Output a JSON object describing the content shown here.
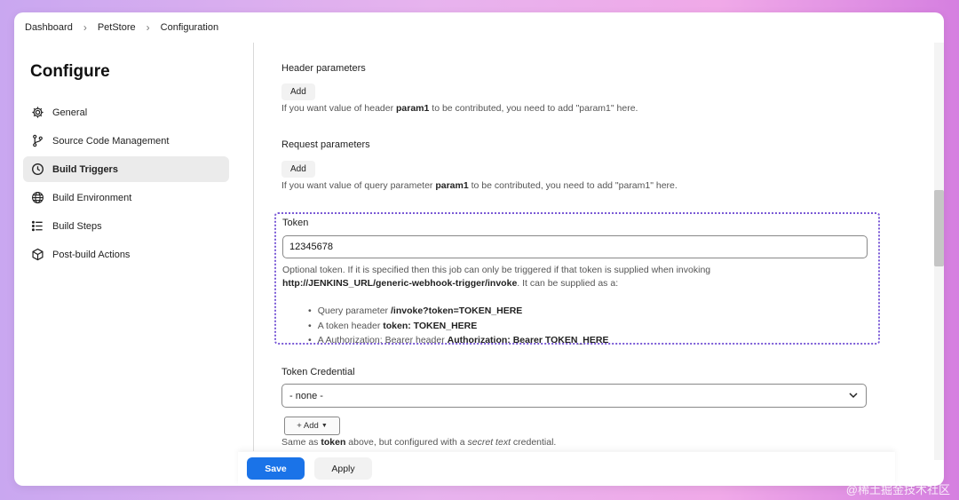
{
  "breadcrumb": [
    "Dashboard",
    "PetStore",
    "Configuration"
  ],
  "sidebar": {
    "title": "Configure",
    "items": [
      {
        "label": "General",
        "icon": "gear-icon",
        "active": false
      },
      {
        "label": "Source Code Management",
        "icon": "branch-icon",
        "active": false
      },
      {
        "label": "Build Triggers",
        "icon": "clock-icon",
        "active": true
      },
      {
        "label": "Build Environment",
        "icon": "globe-icon",
        "active": false
      },
      {
        "label": "Build Steps",
        "icon": "list-icon",
        "active": false
      },
      {
        "label": "Post-build Actions",
        "icon": "cube-icon",
        "active": false
      }
    ]
  },
  "header_params": {
    "label": "Header parameters",
    "add_label": "Add",
    "help_pre": "If you want value of header ",
    "help_bold": "param1",
    "help_post": " to be contributed, you need to add \"param1\" here."
  },
  "request_params": {
    "label": "Request parameters",
    "add_label": "Add",
    "help_pre": "If you want value of query parameter ",
    "help_bold": "param1",
    "help_post": " to be contributed, you need to add \"param1\" here."
  },
  "token": {
    "label": "Token",
    "value": "12345678",
    "help_line1": "Optional token. If it is specified then this job can only be triggered if that token is supplied when invoking",
    "help_url": "http://JENKINS_URL/generic-webhook-trigger/invoke",
    "help_line2_post": ". It can be supplied as a:",
    "options": [
      {
        "pre": "Query parameter ",
        "bold": "/invoke?token=TOKEN_HERE"
      },
      {
        "pre": "A token header ",
        "bold": "token: TOKEN_HERE"
      },
      {
        "pre": "A Authorization: Bearer header ",
        "bold": "Authorization: Bearer TOKEN_HERE"
      }
    ]
  },
  "token_credential": {
    "label": "Token Credential",
    "selected": "- none -",
    "add_label": "+ Add",
    "help_pre": "Same as ",
    "help_bold": "token",
    "help_mid": " above, but configured with a ",
    "help_italic": "secret text",
    "help_post": " credential."
  },
  "footer": {
    "save_label": "Save",
    "apply_label": "Apply"
  },
  "watermark": "@稀土掘金技术社区",
  "colors": {
    "accent": "#1a73e8",
    "focus_outline": "#7a5ad6"
  }
}
